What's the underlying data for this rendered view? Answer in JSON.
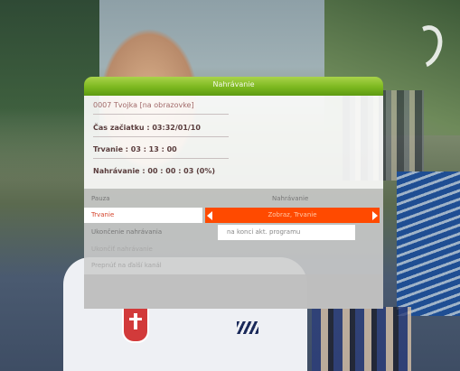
{
  "dialog": {
    "title": "Nahrávanie",
    "channel_line": "0007 Tvojka [na obrazovke]",
    "start_line": "Čas začiatku : 03:32/01/10",
    "duration_line": "Trvanie : 03 : 13 : 00",
    "recorded_line": "Nahrávanie : 00 : 00 : 03 (0%)"
  },
  "menu": {
    "rows": [
      {
        "label": "Pauza",
        "value": "Nahrávanie"
      },
      {
        "label": "Trvanie",
        "value": "Zobraz, Trvanie"
      },
      {
        "label": "Ukončenie nahrávania",
        "value": "na konci akt. programu"
      },
      {
        "label": "Ukončiť nahrávanie",
        "value": ""
      },
      {
        "label": "Prepnúť na ďalší kanál",
        "value": ""
      }
    ]
  },
  "colors": {
    "title_bar": "#7cb81f",
    "selection": "#ff4a00"
  },
  "icons": {
    "left": "arrow-left-icon",
    "right": "arrow-right-icon",
    "channel_logo": "channel-logo-icon"
  }
}
